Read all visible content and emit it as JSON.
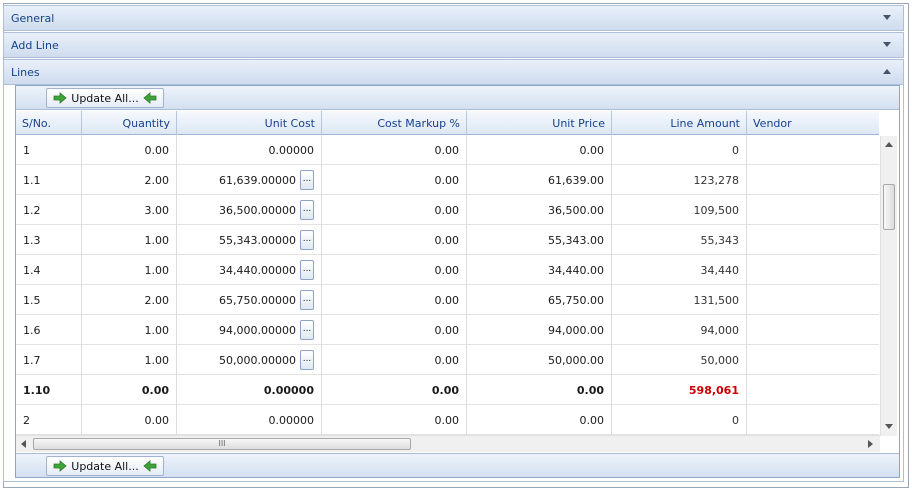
{
  "sections": {
    "general": "General",
    "add_line": "Add Line",
    "lines": "Lines"
  },
  "toolbar": {
    "update_all_label": "Update All..."
  },
  "grid": {
    "columns": [
      "S/No.",
      "Quantity",
      "Unit Cost",
      "Cost Markup %",
      "Unit Price",
      "Line Amount",
      "Vendor"
    ],
    "rows": [
      {
        "sno": "1",
        "qty": "0.00",
        "cost": "0.00000",
        "markup": "0.00",
        "price": "0.00",
        "amount": "0",
        "vendor": "",
        "has_btn": false,
        "bold": false
      },
      {
        "sno": "1.1",
        "qty": "2.00",
        "cost": "61,639.00000",
        "markup": "0.00",
        "price": "61,639.00",
        "amount": "123,278",
        "vendor": "",
        "has_btn": true,
        "bold": false
      },
      {
        "sno": "1.2",
        "qty": "3.00",
        "cost": "36,500.00000",
        "markup": "0.00",
        "price": "36,500.00",
        "amount": "109,500",
        "vendor": "",
        "has_btn": true,
        "bold": false
      },
      {
        "sno": "1.3",
        "qty": "1.00",
        "cost": "55,343.00000",
        "markup": "0.00",
        "price": "55,343.00",
        "amount": "55,343",
        "vendor": "",
        "has_btn": true,
        "bold": false
      },
      {
        "sno": "1.4",
        "qty": "1.00",
        "cost": "34,440.00000",
        "markup": "0.00",
        "price": "34,440.00",
        "amount": "34,440",
        "vendor": "",
        "has_btn": true,
        "bold": false
      },
      {
        "sno": "1.5",
        "qty": "2.00",
        "cost": "65,750.00000",
        "markup": "0.00",
        "price": "65,750.00",
        "amount": "131,500",
        "vendor": "",
        "has_btn": true,
        "bold": false
      },
      {
        "sno": "1.6",
        "qty": "1.00",
        "cost": "94,000.00000",
        "markup": "0.00",
        "price": "94,000.00",
        "amount": "94,000",
        "vendor": "",
        "has_btn": true,
        "bold": false
      },
      {
        "sno": "1.7",
        "qty": "1.00",
        "cost": "50,000.00000",
        "markup": "0.00",
        "price": "50,000.00",
        "amount": "50,000",
        "vendor": "",
        "has_btn": true,
        "bold": false
      },
      {
        "sno": "1.10",
        "qty": "0.00",
        "cost": "0.00000",
        "markup": "0.00",
        "price": "0.00",
        "amount": "598,061",
        "vendor": "",
        "has_btn": false,
        "bold": true
      },
      {
        "sno": "2",
        "qty": "0.00",
        "cost": "0.00000",
        "markup": "0.00",
        "price": "0.00",
        "amount": "0",
        "vendor": "",
        "has_btn": false,
        "bold": false
      }
    ]
  },
  "ellipsis_label": "...",
  "hscroll_grip": "III",
  "colors": {
    "header_text": "#15428b",
    "total_amount": "#cc0000",
    "arrow_green": "#3fa33a"
  }
}
